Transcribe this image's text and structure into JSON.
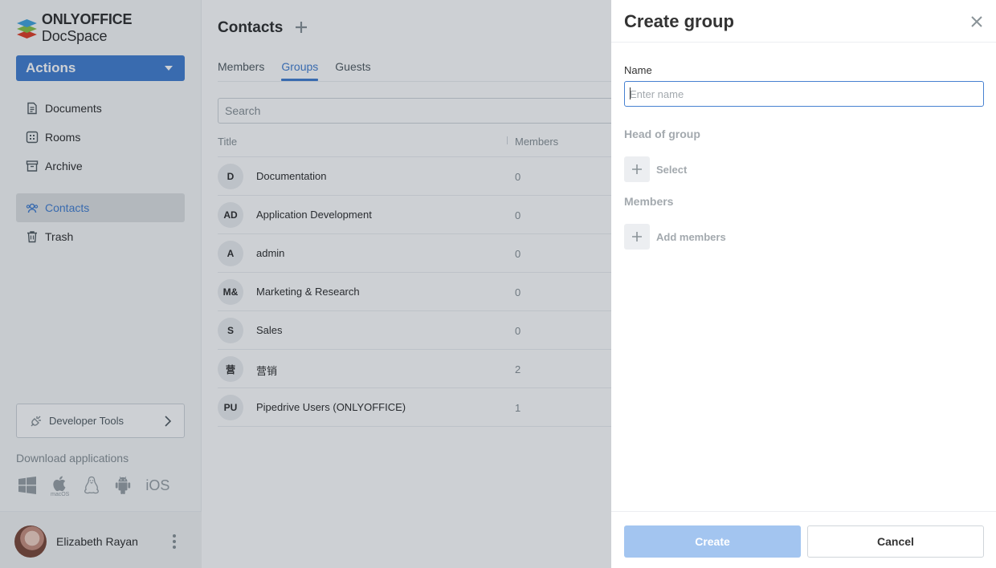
{
  "brand": {
    "name_bold": "ONLYOFFICE",
    "name_light": "DocSpace",
    "accent": "#4781d1"
  },
  "sidebar": {
    "actions_label": "Actions",
    "items": [
      {
        "label": "Documents",
        "icon": "document-icon"
      },
      {
        "label": "Rooms",
        "icon": "rooms-icon"
      },
      {
        "label": "Archive",
        "icon": "archive-icon"
      },
      {
        "label": "Contacts",
        "icon": "contacts-icon",
        "active": true
      },
      {
        "label": "Trash",
        "icon": "trash-icon"
      }
    ],
    "developer_tools": "Developer Tools",
    "download_title": "Download applications",
    "download_apps": [
      "windows-icon",
      "macos-icon",
      "linux-icon",
      "android-icon",
      "iOS"
    ],
    "macos_caption": "macOS",
    "ios_label": "iOS"
  },
  "profile": {
    "name": "Elizabeth Rayan"
  },
  "main": {
    "title": "Contacts",
    "tabs": [
      {
        "label": "Members"
      },
      {
        "label": "Groups",
        "active": true
      },
      {
        "label": "Guests"
      }
    ],
    "search_placeholder": "Search",
    "columns": {
      "title": "Title",
      "members": "Members"
    },
    "rows": [
      {
        "initials": "D",
        "title": "Documentation",
        "members": "0"
      },
      {
        "initials": "AD",
        "title": "Application Development",
        "members": "0"
      },
      {
        "initials": "A",
        "title": "admin",
        "members": "0"
      },
      {
        "initials": "M&",
        "title": "Marketing & Research",
        "members": "0"
      },
      {
        "initials": "S",
        "title": "Sales",
        "members": "0"
      },
      {
        "initials": "营",
        "title": "营销",
        "members": "2"
      },
      {
        "initials": "PU",
        "title": "Pipedrive Users (ONLYOFFICE)",
        "members": "1"
      }
    ]
  },
  "panel": {
    "title": "Create group",
    "name_label": "Name",
    "name_placeholder": "Enter name",
    "name_value": "",
    "head_label": "Head of group",
    "head_select": "Select",
    "members_label": "Members",
    "add_members": "Add members",
    "create_label": "Create",
    "cancel_label": "Cancel"
  }
}
